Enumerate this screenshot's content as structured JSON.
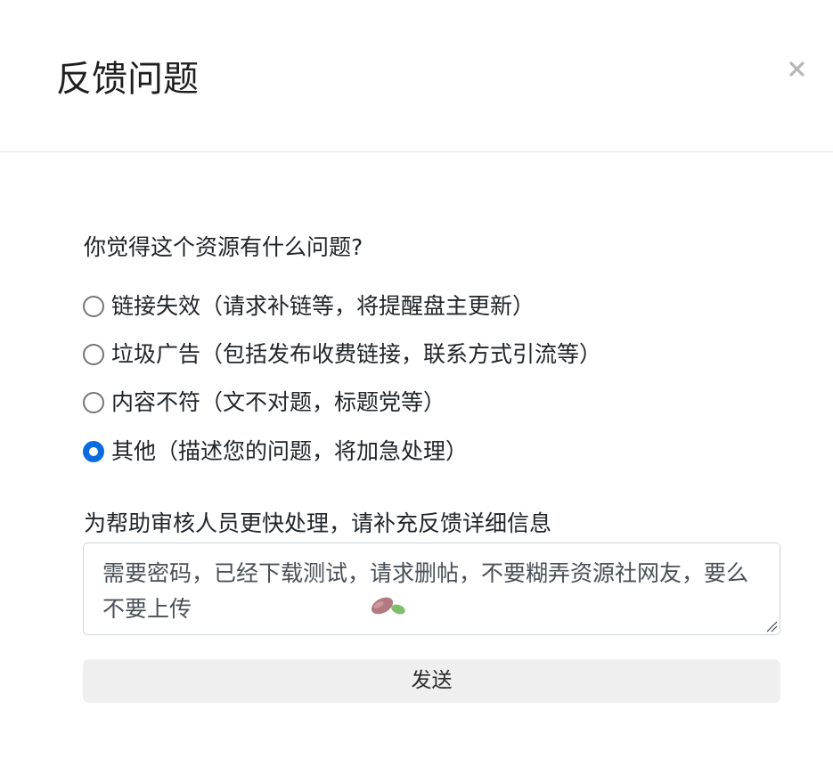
{
  "dialog": {
    "title": "反馈问题",
    "close_symbol": "×"
  },
  "form": {
    "question": "你觉得这个资源有什么问题?",
    "options": [
      {
        "label": "链接失效（请求补链等，将提醒盘主更新）",
        "selected": false
      },
      {
        "label": "垃圾广告（包括发布收费链接，联系方式引流等）",
        "selected": false
      },
      {
        "label": "内容不符（文不对题，标题党等）",
        "selected": false
      },
      {
        "label": "其他（描述您的问题，将加急处理）",
        "selected": true
      }
    ],
    "detail_label": "为帮助审核人员更快处理，请补充反馈详细信息",
    "detail_value": "需要密码，已经下载测试，请求删帖，不要糊弄资源社网友，要么不要上传",
    "submit_label": "发送"
  },
  "icons": {
    "close": "close-icon",
    "emoji": "leaf-emoji-icon",
    "resize": "resize-handle-icon"
  },
  "colors": {
    "radio_selected": "#0b6ce0",
    "button_bg": "#efefef",
    "divider": "#e5e5e5"
  }
}
